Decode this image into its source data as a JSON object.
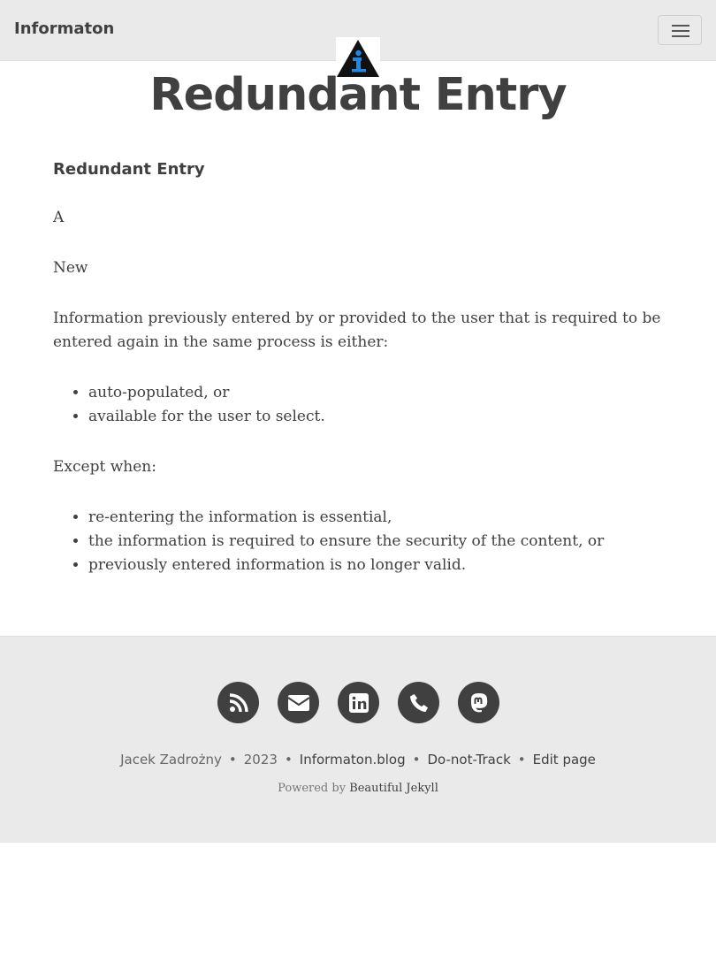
{
  "navbar": {
    "brand": "Informaton",
    "menu_icon": "hamburger-menu-icon",
    "logo_icon": "info-triangle-logo-icon"
  },
  "header": {
    "title": "Redundant Entry"
  },
  "content": {
    "subtitle": "Redundant Entry",
    "level": "A",
    "status": "New",
    "intro": "Information previously entered by or provided to the user that is required to be entered again in the same process is either:",
    "either_list": [
      "auto-populated, or",
      "available for the user to select."
    ],
    "except_label": "Except when:",
    "except_list": [
      "re-entering the information is essential,",
      "the information is required to ensure the security of the content, or",
      "previously entered information is no longer valid."
    ]
  },
  "footer": {
    "social_icons": [
      "rss-icon",
      "email-icon",
      "linkedin-icon",
      "phone-icon",
      "mastodon-icon"
    ],
    "author": "Jacek Zadrożny",
    "year": "2023",
    "blog_link": "Informaton.blog",
    "dnt_link": "Do-not-Track",
    "edit_link": "Edit page",
    "powered_prefix": "Powered by",
    "powered_link": "Beautiful Jekyll"
  },
  "colors": {
    "text": "#404040",
    "nav_bg": "#eaeaea",
    "logo_blue": "#1e88e5"
  }
}
